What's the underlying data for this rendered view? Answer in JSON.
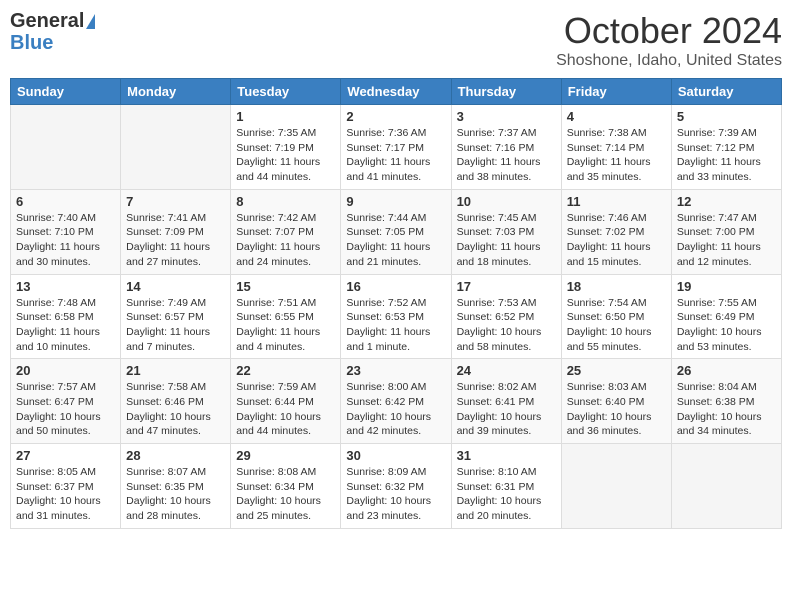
{
  "app": {
    "logo_general": "General",
    "logo_blue": "Blue",
    "month_title": "October 2024",
    "location": "Shoshone, Idaho, United States"
  },
  "calendar": {
    "headers": [
      "Sunday",
      "Monday",
      "Tuesday",
      "Wednesday",
      "Thursday",
      "Friday",
      "Saturday"
    ],
    "weeks": [
      [
        {
          "day": "",
          "info": ""
        },
        {
          "day": "",
          "info": ""
        },
        {
          "day": "1",
          "info": "Sunrise: 7:35 AM\nSunset: 7:19 PM\nDaylight: 11 hours and 44 minutes."
        },
        {
          "day": "2",
          "info": "Sunrise: 7:36 AM\nSunset: 7:17 PM\nDaylight: 11 hours and 41 minutes."
        },
        {
          "day": "3",
          "info": "Sunrise: 7:37 AM\nSunset: 7:16 PM\nDaylight: 11 hours and 38 minutes."
        },
        {
          "day": "4",
          "info": "Sunrise: 7:38 AM\nSunset: 7:14 PM\nDaylight: 11 hours and 35 minutes."
        },
        {
          "day": "5",
          "info": "Sunrise: 7:39 AM\nSunset: 7:12 PM\nDaylight: 11 hours and 33 minutes."
        }
      ],
      [
        {
          "day": "6",
          "info": "Sunrise: 7:40 AM\nSunset: 7:10 PM\nDaylight: 11 hours and 30 minutes."
        },
        {
          "day": "7",
          "info": "Sunrise: 7:41 AM\nSunset: 7:09 PM\nDaylight: 11 hours and 27 minutes."
        },
        {
          "day": "8",
          "info": "Sunrise: 7:42 AM\nSunset: 7:07 PM\nDaylight: 11 hours and 24 minutes."
        },
        {
          "day": "9",
          "info": "Sunrise: 7:44 AM\nSunset: 7:05 PM\nDaylight: 11 hours and 21 minutes."
        },
        {
          "day": "10",
          "info": "Sunrise: 7:45 AM\nSunset: 7:03 PM\nDaylight: 11 hours and 18 minutes."
        },
        {
          "day": "11",
          "info": "Sunrise: 7:46 AM\nSunset: 7:02 PM\nDaylight: 11 hours and 15 minutes."
        },
        {
          "day": "12",
          "info": "Sunrise: 7:47 AM\nSunset: 7:00 PM\nDaylight: 11 hours and 12 minutes."
        }
      ],
      [
        {
          "day": "13",
          "info": "Sunrise: 7:48 AM\nSunset: 6:58 PM\nDaylight: 11 hours and 10 minutes."
        },
        {
          "day": "14",
          "info": "Sunrise: 7:49 AM\nSunset: 6:57 PM\nDaylight: 11 hours and 7 minutes."
        },
        {
          "day": "15",
          "info": "Sunrise: 7:51 AM\nSunset: 6:55 PM\nDaylight: 11 hours and 4 minutes."
        },
        {
          "day": "16",
          "info": "Sunrise: 7:52 AM\nSunset: 6:53 PM\nDaylight: 11 hours and 1 minute."
        },
        {
          "day": "17",
          "info": "Sunrise: 7:53 AM\nSunset: 6:52 PM\nDaylight: 10 hours and 58 minutes."
        },
        {
          "day": "18",
          "info": "Sunrise: 7:54 AM\nSunset: 6:50 PM\nDaylight: 10 hours and 55 minutes."
        },
        {
          "day": "19",
          "info": "Sunrise: 7:55 AM\nSunset: 6:49 PM\nDaylight: 10 hours and 53 minutes."
        }
      ],
      [
        {
          "day": "20",
          "info": "Sunrise: 7:57 AM\nSunset: 6:47 PM\nDaylight: 10 hours and 50 minutes."
        },
        {
          "day": "21",
          "info": "Sunrise: 7:58 AM\nSunset: 6:46 PM\nDaylight: 10 hours and 47 minutes."
        },
        {
          "day": "22",
          "info": "Sunrise: 7:59 AM\nSunset: 6:44 PM\nDaylight: 10 hours and 44 minutes."
        },
        {
          "day": "23",
          "info": "Sunrise: 8:00 AM\nSunset: 6:42 PM\nDaylight: 10 hours and 42 minutes."
        },
        {
          "day": "24",
          "info": "Sunrise: 8:02 AM\nSunset: 6:41 PM\nDaylight: 10 hours and 39 minutes."
        },
        {
          "day": "25",
          "info": "Sunrise: 8:03 AM\nSunset: 6:40 PM\nDaylight: 10 hours and 36 minutes."
        },
        {
          "day": "26",
          "info": "Sunrise: 8:04 AM\nSunset: 6:38 PM\nDaylight: 10 hours and 34 minutes."
        }
      ],
      [
        {
          "day": "27",
          "info": "Sunrise: 8:05 AM\nSunset: 6:37 PM\nDaylight: 10 hours and 31 minutes."
        },
        {
          "day": "28",
          "info": "Sunrise: 8:07 AM\nSunset: 6:35 PM\nDaylight: 10 hours and 28 minutes."
        },
        {
          "day": "29",
          "info": "Sunrise: 8:08 AM\nSunset: 6:34 PM\nDaylight: 10 hours and 25 minutes."
        },
        {
          "day": "30",
          "info": "Sunrise: 8:09 AM\nSunset: 6:32 PM\nDaylight: 10 hours and 23 minutes."
        },
        {
          "day": "31",
          "info": "Sunrise: 8:10 AM\nSunset: 6:31 PM\nDaylight: 10 hours and 20 minutes."
        },
        {
          "day": "",
          "info": ""
        },
        {
          "day": "",
          "info": ""
        }
      ]
    ]
  }
}
